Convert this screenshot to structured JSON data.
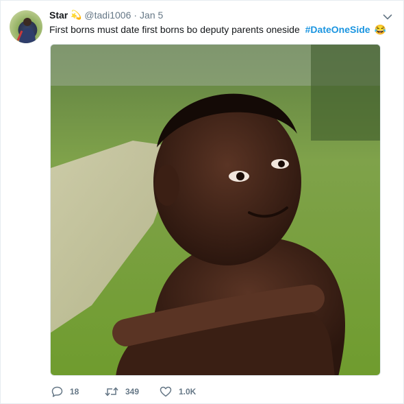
{
  "tweet": {
    "author_name": "Star",
    "author_emoji": "💫",
    "handle": "@tadi1006",
    "separator": "·",
    "date": "Jan 5",
    "text": "First borns must date first borns bo deputy parents oneside",
    "hashtag": "#DateOneSide",
    "text_emoji": "😂"
  },
  "actions": {
    "replies": "18",
    "retweets": "349",
    "likes": "1.0K"
  },
  "icons": {
    "reply": "reply-icon",
    "retweet": "retweet-icon",
    "like": "heart-icon",
    "menu": "chevron-down-icon"
  },
  "colors": {
    "link": "#1b95e0",
    "muted": "#657786",
    "text": "#14171a",
    "border": "#e6ecf0"
  }
}
